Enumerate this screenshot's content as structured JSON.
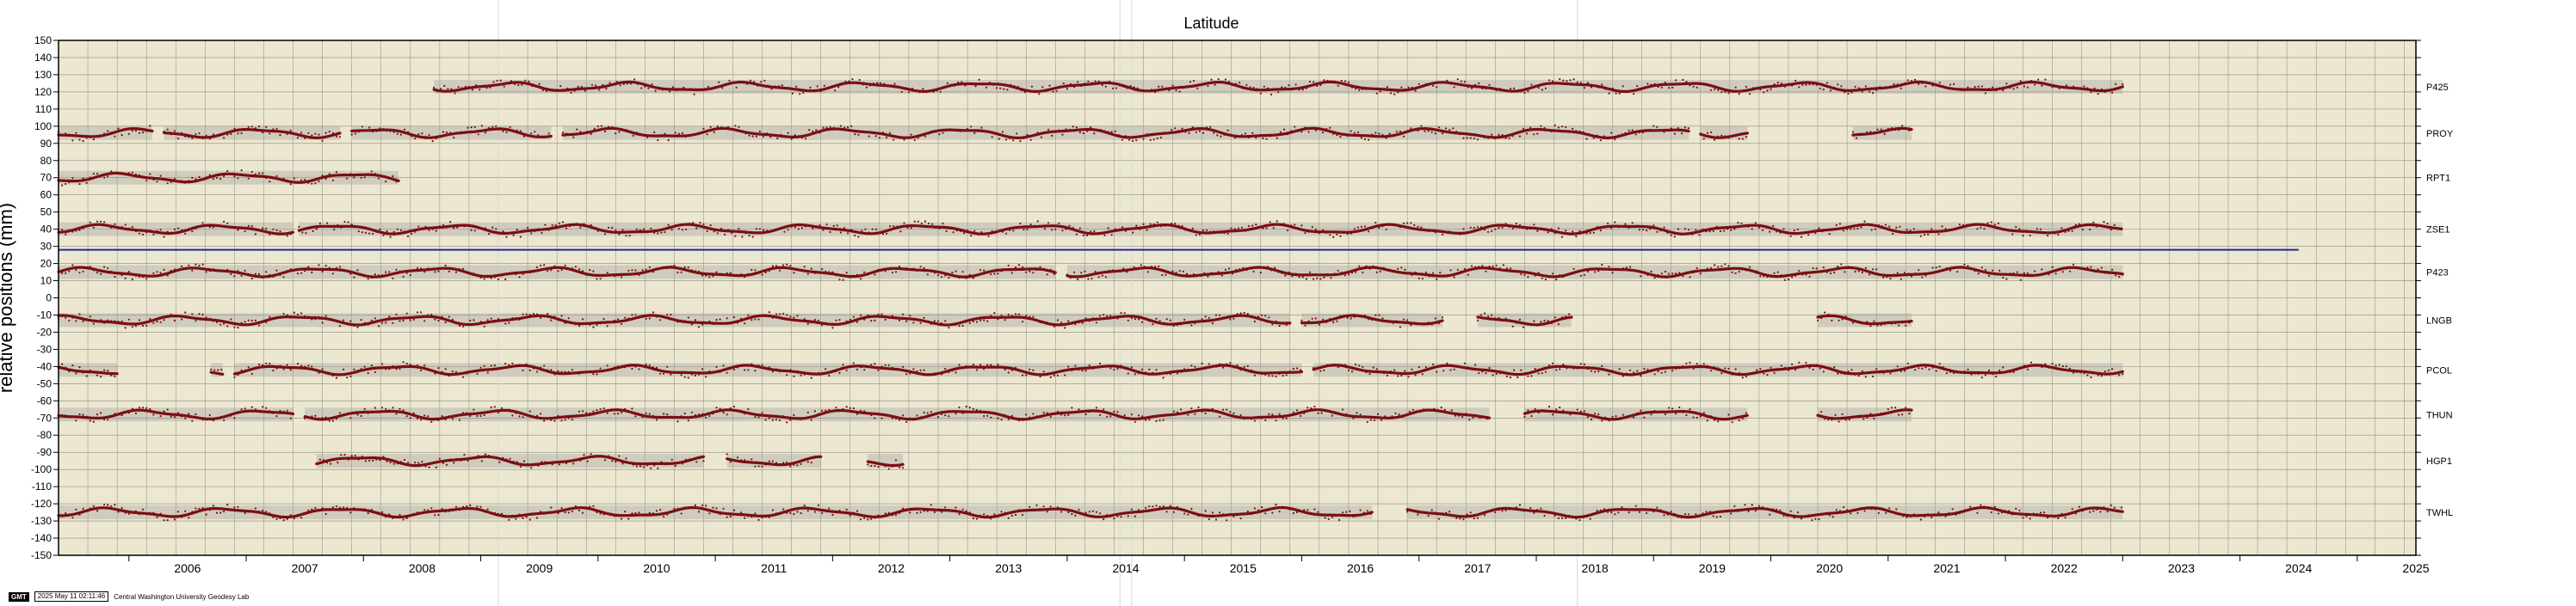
{
  "chart_data": {
    "type": "scatter",
    "title": "Latitude",
    "ylabel": "relative positions (mm)",
    "xlabel": "",
    "xlim": [
      2005.4,
      2025.5
    ],
    "ylim": [
      -150,
      150
    ],
    "x_ticks": [
      "2006",
      "2007",
      "2008",
      "2009",
      "2010",
      "2011",
      "2012",
      "2013",
      "2014",
      "2015",
      "2016",
      "2017",
      "2018",
      "2019",
      "2020",
      "2021",
      "2022",
      "2023",
      "2024",
      "2025"
    ],
    "y_ticks": [
      150,
      140,
      130,
      120,
      110,
      100,
      90,
      80,
      70,
      60,
      50,
      40,
      30,
      20,
      10,
      0,
      -10,
      -20,
      -30,
      -40,
      -50,
      -60,
      -70,
      -80,
      -90,
      -100,
      -110,
      -120,
      -130,
      -140,
      -150
    ],
    "grid": true,
    "background_color": "#ece7d0",
    "point_color": "#7a0f12",
    "band_color": "#9c9c9c",
    "reference_line": {
      "y": 28,
      "x_start": 2005.4,
      "x_end": 2024.5,
      "color": "#1f2a9c"
    },
    "vertical_markers": [
      2009.15,
      2014.45,
      2014.55,
      2018.35
    ],
    "series": [
      {
        "name": "P425",
        "offset": 123,
        "segments": [
          [
            2008.6,
            2023.0
          ]
        ]
      },
      {
        "name": "PROY",
        "offset": 96,
        "segments": [
          [
            2005.4,
            2006.2
          ],
          [
            2006.3,
            2007.8
          ],
          [
            2007.9,
            2009.6
          ],
          [
            2009.7,
            2019.3
          ],
          [
            2019.4,
            2019.8
          ],
          [
            2020.7,
            2021.2
          ]
        ]
      },
      {
        "name": "RPT1",
        "offset": 70,
        "segments": [
          [
            2005.4,
            2008.3
          ]
        ]
      },
      {
        "name": "ZSE1",
        "offset": 40,
        "segments": [
          [
            2005.4,
            2007.4
          ],
          [
            2007.45,
            2023.0
          ]
        ]
      },
      {
        "name": "P423",
        "offset": 15,
        "segments": [
          [
            2005.4,
            2013.9
          ],
          [
            2014.0,
            2023.0
          ]
        ]
      },
      {
        "name": "LNGB",
        "offset": -13,
        "segments": [
          [
            2005.4,
            2015.9
          ],
          [
            2016.0,
            2017.2
          ],
          [
            2017.5,
            2018.3
          ],
          [
            2020.4,
            2021.2
          ]
        ]
      },
      {
        "name": "PCOL",
        "offset": -42,
        "segments": [
          [
            2005.4,
            2005.9
          ],
          [
            2006.7,
            2006.8
          ],
          [
            2006.9,
            2016.0
          ],
          [
            2016.1,
            2023.0
          ]
        ]
      },
      {
        "name": "THUN",
        "offset": -68,
        "segments": [
          [
            2005.4,
            2007.4
          ],
          [
            2007.5,
            2017.6
          ],
          [
            2017.9,
            2019.8
          ],
          [
            2020.4,
            2021.2
          ]
        ]
      },
      {
        "name": "HGP1",
        "offset": -95,
        "segments": [
          [
            2007.6,
            2010.9
          ],
          [
            2011.1,
            2011.9
          ],
          [
            2012.3,
            2012.6
          ]
        ]
      },
      {
        "name": "TWHL",
        "offset": -125,
        "segments": [
          [
            2005.4,
            2016.6
          ],
          [
            2016.9,
            2023.0
          ]
        ]
      }
    ]
  },
  "footer": {
    "logo": "GMT",
    "timestamp": "2025 May 11 02:11:46",
    "credit": "Central Washington University Geodesy Lab"
  }
}
